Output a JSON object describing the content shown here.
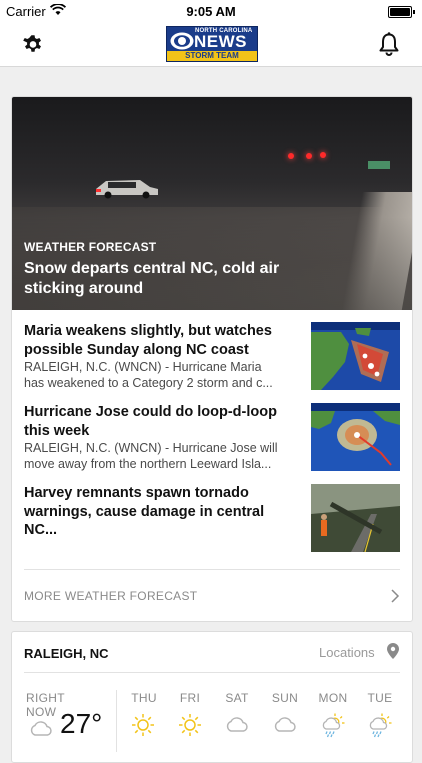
{
  "status_bar": {
    "carrier": "Carrier",
    "time": "9:05 AM"
  },
  "header": {
    "logo": {
      "line1": "NORTH CAROLINA",
      "line2": "NEWS",
      "line3": "STORM TEAM"
    },
    "icons": [
      "gear-icon",
      "bell-icon"
    ]
  },
  "featured": {
    "category": "WEATHER FORECAST",
    "headline": "Snow departs central NC, cold air sticking around"
  },
  "stories": [
    {
      "title": "Maria weakens slightly, but watches possible Sunday along NC coast",
      "summary_line1": "RALEIGH, N.C. (WNCN) - Hurricane Maria",
      "summary_line2": "has weakened to a Category 2 storm and c..."
    },
    {
      "title": "Hurricane Jose could do loop-d-loop this week",
      "summary_line1": "RALEIGH, N.C. (WNCN) - Hurricane Jose will",
      "summary_line2": "move away from the northern Leeward Isla..."
    },
    {
      "title": "Harvey remnants spawn tornado warnings, cause damage in central NC...",
      "summary_line1": "",
      "summary_line2": ""
    }
  ],
  "more_link": "MORE WEATHER FORECAST",
  "weather": {
    "city": "RALEIGH, NC",
    "locations_label": "Locations",
    "now_label": "RIGHT NOW",
    "now_temp": "27°",
    "now_icon": "cloud-icon",
    "days": [
      {
        "label": "THU",
        "icon": "sun-icon"
      },
      {
        "label": "FRI",
        "icon": "sun-icon"
      },
      {
        "label": "SAT",
        "icon": "cloud-icon"
      },
      {
        "label": "SUN",
        "icon": "cloud-icon"
      },
      {
        "label": "MON",
        "icon": "sun-rain-icon"
      },
      {
        "label": "TUE",
        "icon": "sun-rain-icon"
      }
    ],
    "colors": {
      "sun": "#f2c318",
      "cloud": "#b5b5b5",
      "rain": "#6fb6e0"
    }
  },
  "colors": {
    "brand_blue": "#1a3c8a",
    "brand_yellow": "#f2c318",
    "background": "#efefef"
  }
}
